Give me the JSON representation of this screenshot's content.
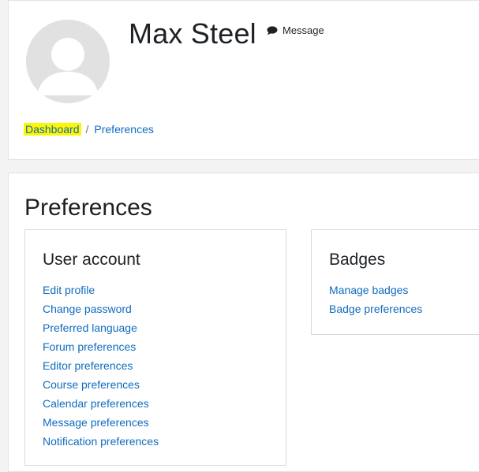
{
  "profile": {
    "name": "Max Steel",
    "message_label": "Message",
    "avatar_icon": "default-user-avatar",
    "message_icon": "speech-bubble-icon"
  },
  "breadcrumb": {
    "items": [
      "Dashboard",
      "Preferences"
    ],
    "separator": "/"
  },
  "page": {
    "title": "Preferences"
  },
  "sections": {
    "user_account": {
      "title": "User account",
      "links": [
        "Edit profile",
        "Change password",
        "Preferred language",
        "Forum preferences",
        "Editor preferences",
        "Course preferences",
        "Calendar preferences",
        "Message preferences",
        "Notification preferences"
      ]
    },
    "badges": {
      "title": "Badges",
      "links": [
        "Manage badges",
        "Badge preferences"
      ]
    }
  },
  "colors": {
    "link": "#0f6cbf",
    "highlight": "#fff700",
    "avatar_bg": "#e1e1e1",
    "avatar_fg": "#ffffff"
  }
}
